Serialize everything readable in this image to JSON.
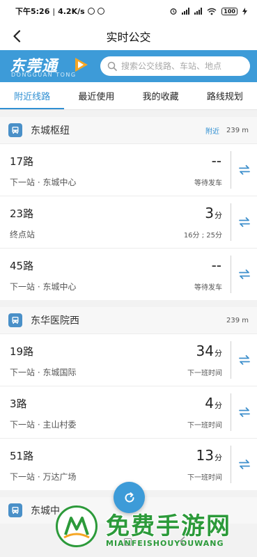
{
  "status_bar": {
    "time": "下午5:26",
    "speed": "4.2K/s",
    "battery": "100"
  },
  "header": {
    "title": "实时公交"
  },
  "brand": {
    "logo_cn": "东莞通",
    "logo_en": "DONGGUAN TONG",
    "search_placeholder": "搜索公交线路、车站、地点"
  },
  "tabs": [
    {
      "label": "附近线路",
      "active": true
    },
    {
      "label": "最近使用",
      "active": false
    },
    {
      "label": "我的收藏",
      "active": false
    },
    {
      "label": "路线规划",
      "active": false
    }
  ],
  "stations": [
    {
      "name": "东城枢纽",
      "near_label": "附近",
      "distance": "239 m",
      "routes": [
        {
          "name": "17路",
          "next": "下一站 · 东城中心",
          "time": "--",
          "unit": "",
          "status": "等待发车"
        },
        {
          "name": "23路",
          "next": "终点站",
          "time": "3",
          "unit": "分",
          "status": "16分 ; 25分"
        },
        {
          "name": "45路",
          "next": "下一站 · 东城中心",
          "time": "--",
          "unit": "",
          "status": "等待发车"
        }
      ]
    },
    {
      "name": "东华医院西",
      "near_label": "",
      "distance": "239 m",
      "routes": [
        {
          "name": "19路",
          "next": "下一站 · 东城国际",
          "time": "34",
          "unit": "分",
          "status": "下一班时间"
        },
        {
          "name": "3路",
          "next": "下一站 · 主山村委",
          "time": "4",
          "unit": "分",
          "status": "下一班时间"
        },
        {
          "name": "51路",
          "next": "下一站 · 万达广场",
          "time": "13",
          "unit": "分",
          "status": "下一班时间"
        }
      ]
    },
    {
      "name": "东城中",
      "near_label": "",
      "distance": "",
      "routes": []
    }
  ],
  "watermark": {
    "cn": "免费手游网",
    "en": "MIANFEISHOUYOUWANG"
  },
  "colors": {
    "brand_blue": "#3d9bd8",
    "accent_blue": "#2f8fd2",
    "watermark_green": "#2c9a3a"
  },
  "icons": {
    "back": "chevron-left-icon",
    "search": "search-icon",
    "bus": "bus-icon",
    "swap": "swap-arrows-icon",
    "refresh": "refresh-icon"
  }
}
